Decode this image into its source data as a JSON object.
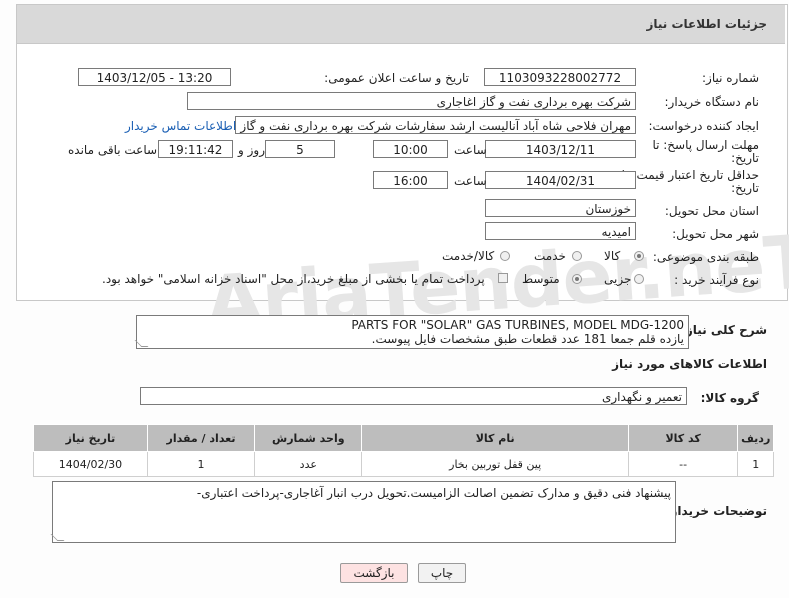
{
  "header": {
    "title": "جزئیات اطلاعات نیاز"
  },
  "form": {
    "need_number_label": "شماره نیاز:",
    "need_number": "1103093228002772",
    "announce_label": "تاریخ و ساعت اعلان عمومی:",
    "announce_value": "1403/12/05 - 13:20",
    "buyer_label": "نام دستگاه خریدار:",
    "buyer_value": "شرکت بهره برداری نفت و گاز اغاجاری",
    "creator_label": "ایجاد کننده درخواست:",
    "creator_value": "مهران فلاحی شاه آباد آنالیست ارشد سفارشات شرکت بهره برداری نفت و گاز ا",
    "contact_link": "اطلاعات تماس خریدار",
    "reply_label_1": "مهلت ارسال پاسخ: تا",
    "reply_label_2": "تاریخ:",
    "reply_date": "1403/12/11",
    "time_label": "ساعت",
    "reply_time": "10:00",
    "days_value": "5",
    "days_label": "روز و",
    "remaining_time": "19:11:42",
    "remaining_label": "ساعت باقی مانده",
    "validity_label_1": "حداقل تاریخ اعتبار قیمت: تا",
    "validity_label_2": "تاریخ:",
    "validity_date": "1404/02/31",
    "validity_time": "16:00",
    "province_label": "استان محل تحویل:",
    "province_value": "خوزستان",
    "city_label": "شهر محل تحویل:",
    "city_value": "امیدیه",
    "category_label": "طبقه بندی موضوعی:",
    "category_options": [
      "کالا",
      "خدمت",
      "کالا/خدمت"
    ],
    "category_selected": "کالا",
    "process_label": "نوع فرآیند خرید :",
    "process_options": [
      "جزیی",
      "متوسط"
    ],
    "process_selected": "متوسط",
    "payment_note": "پرداخت تمام یا بخشی از مبلغ خرید،از محل \"اسناد خزانه اسلامی\" خواهد بود."
  },
  "description": {
    "label": "شرح کلی نیاز:",
    "line1": "PARTS FOR \"SOLAR\" GAS TURBINES, MODEL MDG-1200",
    "line2": "یازده قلم جمعا 181 عدد  قطعات طبق مشخصات فایل پیوست."
  },
  "goods": {
    "section_title": "اطلاعات کالاهای مورد نیاز",
    "group_label": "گروه کالا:",
    "group_value": "تعمیر و نگهداری",
    "table": {
      "headers": [
        "ردیف",
        "کد کالا",
        "نام کالا",
        "واحد شمارش",
        "تعداد / مقدار",
        "تاریخ نیاز"
      ],
      "rows": [
        [
          "1",
          "--",
          "پین قفل توربین بخار",
          "عدد",
          "1",
          "1404/02/30"
        ]
      ]
    }
  },
  "buyer_notes": {
    "label": "توضیحات خریدار:",
    "text": "پیشنهاد فنی دقیق و مدارک تضمین اصالت الزامیست.تحویل درب انبار آغاجاری-پرداخت اعتباری-"
  },
  "buttons": {
    "print": "چاپ",
    "back": "بازگشت"
  },
  "watermark": "AriaTender.neT",
  "colors": {
    "header_bg": "#d9d9d9",
    "table_header_bg": "#bdbdbd",
    "link": "#1a5fb4",
    "back_button_bg": "#fde2e2"
  }
}
